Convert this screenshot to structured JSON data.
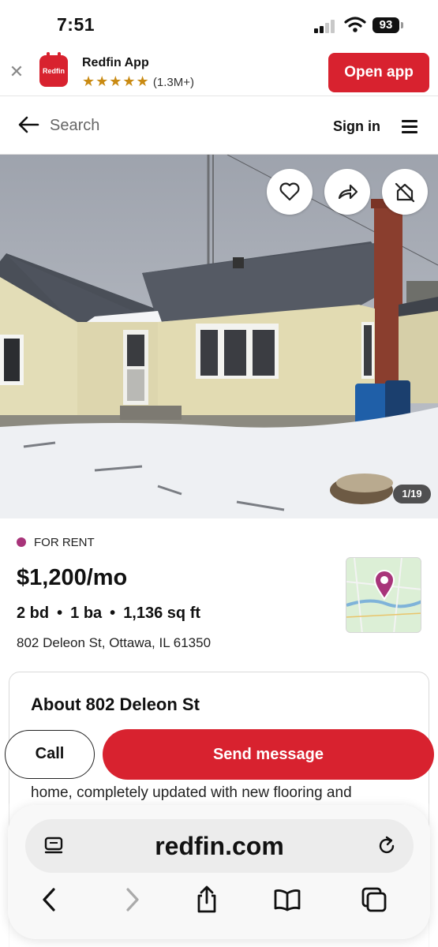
{
  "status_bar": {
    "time": "7:51",
    "battery": "93"
  },
  "app_banner": {
    "app_name": "Redfin App",
    "icon_text": "Redfin",
    "stars": "★★★★★",
    "rating_count": "(1.3M+)",
    "open_label": "Open app"
  },
  "header": {
    "search_placeholder": "Search",
    "signin_label": "Sign in"
  },
  "photo": {
    "counter": "1/19"
  },
  "listing": {
    "status": "FOR RENT",
    "status_color": "#a8347a",
    "price": "$1,200/mo",
    "beds": "2 bd",
    "baths": "1 ba",
    "sqft": "1,136 sq ft",
    "bullet": "•",
    "address": "802 Deleon St, Ottawa, IL 61350"
  },
  "about": {
    "title": "About 802 Deleon St",
    "text": "home, completely updated with new flooring and"
  },
  "actions": {
    "call_label": "Call",
    "send_label": "Send message"
  },
  "browser": {
    "url": "redfin.com"
  },
  "colors": {
    "brand_red": "#d8222f",
    "star_gold": "#c98a12"
  }
}
